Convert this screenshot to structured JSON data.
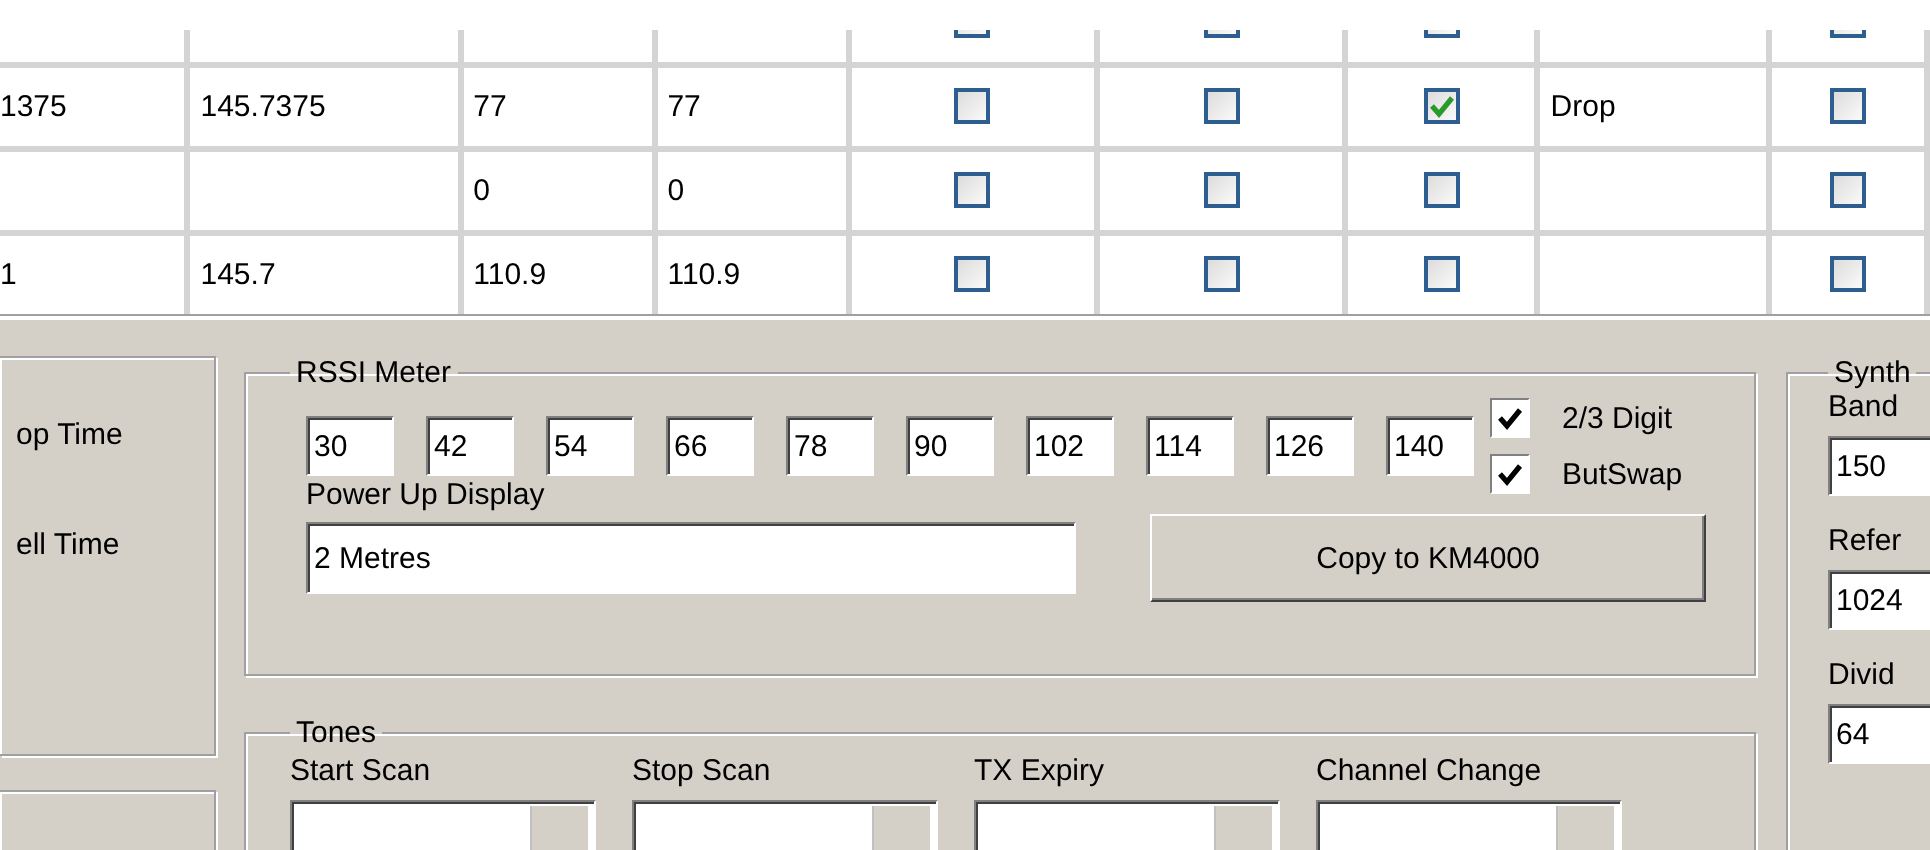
{
  "table": {
    "rows": [
      {
        "column_5": {
          "checked": false
        },
        "column_6": {
          "checked": false
        },
        "column_7": {
          "checked": false
        },
        "column_9": {
          "checked": false
        }
      },
      {
        "column_1": "1375",
        "column_2": "145.7375",
        "column_3": "77",
        "column_4": "77",
        "column_5": {
          "checked": false
        },
        "column_6": {
          "checked": false
        },
        "column_7": {
          "checked": true
        },
        "column_8": "Drop",
        "column_9": {
          "checked": false
        }
      },
      {
        "column_3": "0",
        "column_4": "0",
        "column_5": {
          "checked": false
        },
        "column_6": {
          "checked": false
        },
        "column_7": {
          "checked": false
        },
        "column_9": {
          "checked": false
        }
      },
      {
        "column_1": "1",
        "column_2": "145.7",
        "column_3": "110.9",
        "column_4": "110.9",
        "column_5": {
          "checked": false
        },
        "column_6": {
          "checked": false
        },
        "column_7": {
          "checked": false
        },
        "column_9": {
          "checked": false
        }
      }
    ]
  },
  "left_group": {
    "labels": [
      "op Time",
      "ell Time"
    ]
  },
  "rssi_meter": {
    "title": "RSSI Meter",
    "thresholds": [
      "30",
      "42",
      "54",
      "66",
      "78",
      "90",
      "102",
      "114",
      "126",
      "140"
    ],
    "options": [
      {
        "label": "2/3 Digit",
        "checked": true
      },
      {
        "label": "ButSwap",
        "checked": true
      }
    ],
    "power_up_display": {
      "label": "Power Up Display",
      "value": "2 Metres"
    },
    "copy_button": "Copy to KM4000"
  },
  "tones": {
    "title": "Tones",
    "fields": [
      {
        "label": "Start Scan"
      },
      {
        "label": "Stop Scan"
      },
      {
        "label": "TX Expiry"
      },
      {
        "label": "Channel Change"
      }
    ]
  },
  "synth": {
    "title": "Synth",
    "fields": [
      {
        "label": "Band",
        "value": "150"
      },
      {
        "label": "Refer",
        "value": "1024"
      },
      {
        "label": "Divid",
        "value": "64"
      }
    ]
  }
}
